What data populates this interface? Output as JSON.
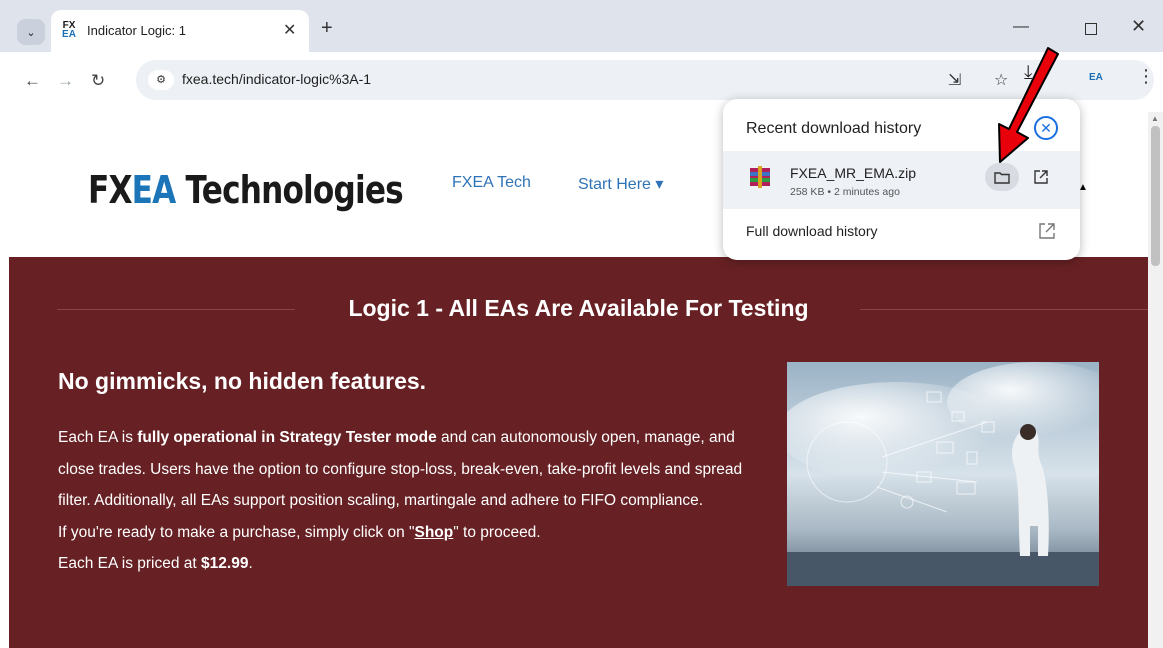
{
  "browser": {
    "tab_title": "Indicator Logic: 1",
    "favicon_text_top": "FX",
    "favicon_text_bottom": "EA",
    "new_tab": "+",
    "url": "fxea.tech/indicator-logic%3A-1",
    "extension_label": "EA"
  },
  "site": {
    "logo_prefix": "FX",
    "logo_accent": "EA",
    "logo_suffix": " Technologies",
    "nav": [
      "FXEA Tech",
      "Start Here ▾"
    ]
  },
  "hero": {
    "title": "Logic 1 - All EAs Are Available For Testing",
    "heading": "No gimmicks, no hidden features.",
    "body_1a": "Each EA is ",
    "body_1b": "fully operational in Strategy Tester mode",
    "body_1c": " and can autonomously open, manage, and close trades. Users have the option to configure stop-loss, break-even, take-profit levels and spread filter. Additionally, all EAs support position scaling, martingale and adhere to FIFO compliance.",
    "body_2a": "If you're ready to make a purchase, simply click on \"",
    "body_2b": "Shop",
    "body_2c": "\" to proceed.",
    "body_3a": "Each EA is priced at ",
    "body_3b": "$12.99",
    "body_3c": "."
  },
  "downloads": {
    "header": "Recent download history",
    "file_name": "FXEA_MR_EMA.zip",
    "file_meta": "258 KB • 2 minutes ago",
    "full_history": "Full download history"
  },
  "colors": {
    "hero_bg": "#672124",
    "link_blue": "#2f73b7",
    "logo_blue": "#1d75b9",
    "annotation_arrow": "#e8000b"
  }
}
